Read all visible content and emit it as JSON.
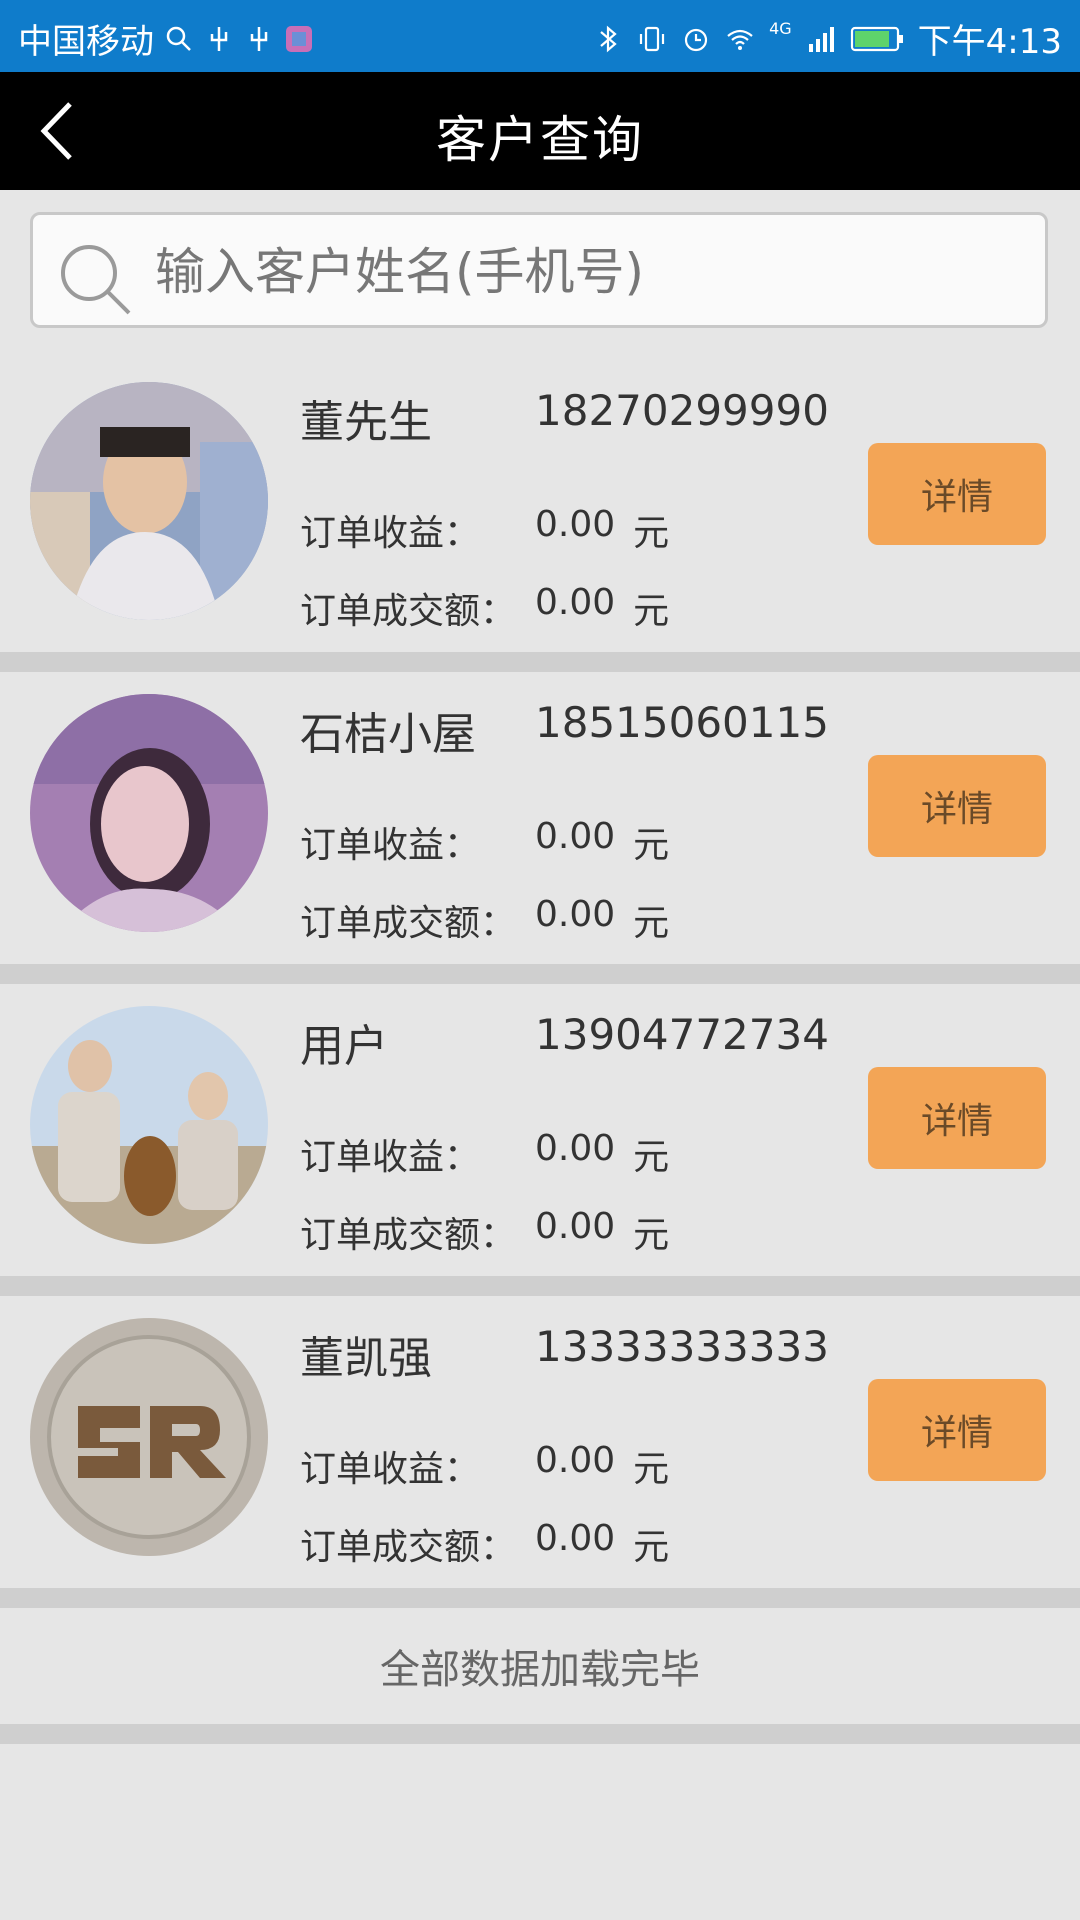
{
  "status_bar": {
    "carrier": "中国移动",
    "time": "下午4:13",
    "network": "4G"
  },
  "header": {
    "title": "客户查询",
    "back_icon": "chevron-left-icon"
  },
  "search": {
    "placeholder": "输入客户姓名(手机号)",
    "icon": "search-icon"
  },
  "customers": [
    {
      "name": "董先生",
      "phone": "18270299990",
      "income_label": "订单收益：",
      "income": "0.00",
      "deal_label": "订单成交额：",
      "deal": "0.00",
      "unit": "元",
      "button": "详情"
    },
    {
      "name": "石桔小屋",
      "phone": "18515060115",
      "income_label": "订单收益：",
      "income": "0.00",
      "deal_label": "订单成交额：",
      "deal": "0.00",
      "unit": "元",
      "button": "详情"
    },
    {
      "name": "用户",
      "phone": "13904772734",
      "income_label": "订单收益：",
      "income": "0.00",
      "deal_label": "订单成交额：",
      "deal": "0.00",
      "unit": "元",
      "button": "详情"
    },
    {
      "name": "董凯强",
      "phone": "13333333333",
      "income_label": "订单收益：",
      "income": "0.00",
      "deal_label": "订单成交额：",
      "deal": "0.00",
      "unit": "元",
      "button": "详情"
    }
  ],
  "footer": {
    "text": "全部数据加载完毕"
  },
  "colors": {
    "status_bar": "#0f7ccb",
    "top_bar": "#000000",
    "button": "#f3a556",
    "background": "#e6e6e6"
  }
}
